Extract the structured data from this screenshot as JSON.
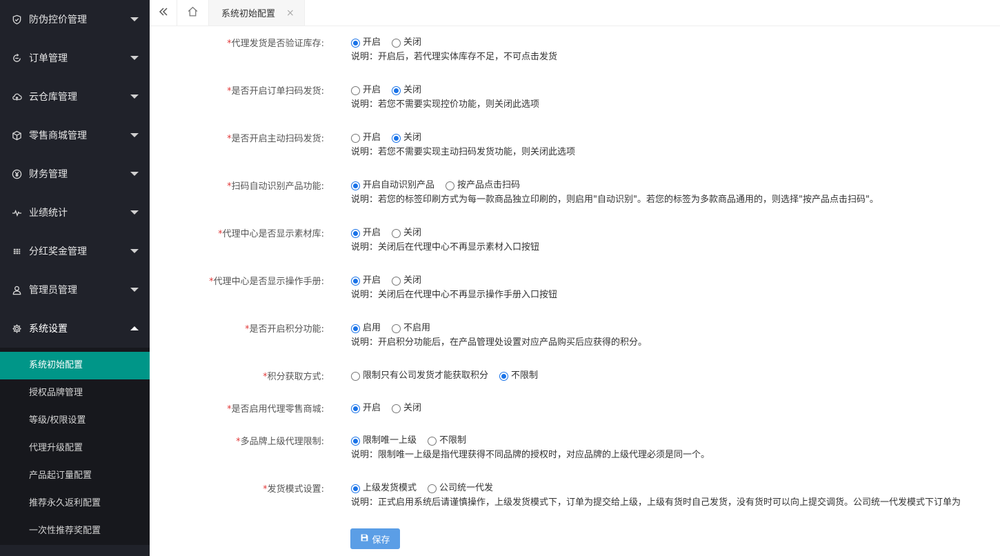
{
  "sidebar": {
    "menus": [
      {
        "label": "防伪控价管理",
        "icon": "shield-icon"
      },
      {
        "label": "订单管理",
        "icon": "order-icon"
      },
      {
        "label": "云仓库管理",
        "icon": "cloud-icon"
      },
      {
        "label": "零售商城管理",
        "icon": "box-icon"
      },
      {
        "label": "财务管理",
        "icon": "yen-icon"
      },
      {
        "label": "业绩统计",
        "icon": "pulse-icon"
      },
      {
        "label": "分红奖金管理",
        "icon": "grid-icon"
      },
      {
        "label": "管理员管理",
        "icon": "user-icon"
      },
      {
        "label": "系统设置",
        "icon": "gear-icon"
      }
    ],
    "submenu": [
      "系统初始配置",
      "授权品牌管理",
      "等级/权限设置",
      "代理升级配置",
      "产品起订量配置",
      "推荐永久返利配置",
      "一次性推荐奖配置"
    ]
  },
  "tabs": {
    "current": "系统初始配置",
    "close": "×"
  },
  "form": {
    "required_mark": "*",
    "rows": [
      {
        "label": "代理发货是否验证库存:",
        "options": [
          "开启",
          "关闭"
        ],
        "selected": 0,
        "desc": "说明：开启后，若代理实体库存不足，不可点击发货"
      },
      {
        "label": "是否开启订单扫码发货:",
        "options": [
          "开启",
          "关闭"
        ],
        "selected": 1,
        "desc": "说明：若您不需要实现控价功能，则关闭此选项"
      },
      {
        "label": "是否开启主动扫码发货:",
        "options": [
          "开启",
          "关闭"
        ],
        "selected": 1,
        "desc": "说明：若您不需要实现主动扫码发货功能，则关闭此选项"
      },
      {
        "label": "扫码自动识别产品功能:",
        "options": [
          "开启自动识别产品",
          "按产品点击扫码"
        ],
        "selected": 0,
        "desc": "说明：若您的标签印刷方式为每一款商品独立印刷的，则启用\"自动识别\"。若您的标签为多款商品通用的，则选择\"按产品点击扫码\"。"
      },
      {
        "label": "代理中心是否显示素材库:",
        "options": [
          "开启",
          "关闭"
        ],
        "selected": 0,
        "desc": "说明：关闭后在代理中心不再显示素材入口按钮"
      },
      {
        "label": "代理中心是否显示操作手册:",
        "options": [
          "开启",
          "关闭"
        ],
        "selected": 0,
        "desc": "说明：关闭后在代理中心不再显示操作手册入口按钮"
      },
      {
        "label": "是否开启积分功能:",
        "options": [
          "启用",
          "不启用"
        ],
        "selected": 0,
        "desc": "说明：开启积分功能后，在产品管理处设置对应产品购买后应获得的积分。"
      },
      {
        "label": "积分获取方式:",
        "options": [
          "限制只有公司发货才能获取积分",
          "不限制"
        ],
        "selected": 1,
        "desc": ""
      },
      {
        "label": "是否启用代理零售商城:",
        "options": [
          "开启",
          "关闭"
        ],
        "selected": 0,
        "desc": ""
      },
      {
        "label": "多品牌上级代理限制:",
        "options": [
          "限制唯一上级",
          "不限制"
        ],
        "selected": 0,
        "desc": "说明：限制唯一上级是指代理获得不同品牌的授权时，对应品牌的上级代理必须是同一个。"
      },
      {
        "label": "发货模式设置:",
        "options": [
          "上级发货模式",
          "公司统一代发"
        ],
        "selected": 0,
        "desc": "说明：正式启用系统后请谨慎操作，上级发货模式下，订单为提交给上级，上级有货时自己发货，没有货时可以向上提交调货。公司统一代发模式下订单为"
      }
    ],
    "save_label": "保存"
  },
  "colors": {
    "sidebar_bg": "#20222a",
    "active_menu": "#009688",
    "radio_checked": "#1a73e8",
    "save_button": "#5b9ee6",
    "required": "#e23b3b"
  }
}
